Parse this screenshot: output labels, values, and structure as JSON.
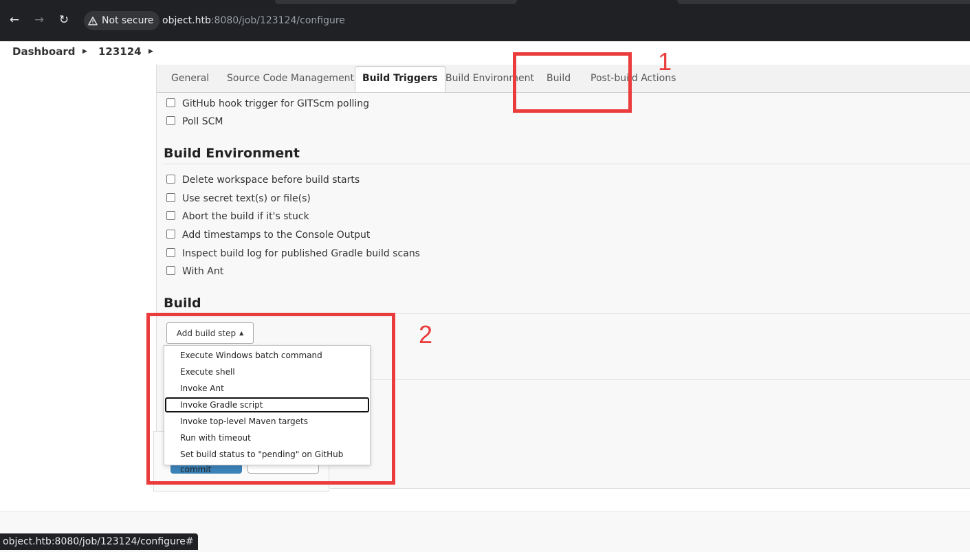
{
  "browser": {
    "security_label": "Not secure",
    "url_host": "object.htb",
    "url_path": ":8080/job/123124/configure",
    "status_url": "object.htb:8080/job/123124/configure#"
  },
  "breadcrumbs": {
    "dashboard": "Dashboard",
    "job": "123124"
  },
  "tabs": [
    {
      "label": "General"
    },
    {
      "label": "Source Code Management"
    },
    {
      "label": "Build Triggers"
    },
    {
      "label": "Build Environment"
    },
    {
      "label": "Build"
    },
    {
      "label": "Post-build Actions"
    }
  ],
  "build_triggers": {
    "options": [
      {
        "label": "GitHub hook trigger for GITScm polling",
        "checked": false
      },
      {
        "label": "Poll SCM",
        "checked": false
      }
    ]
  },
  "build_environment": {
    "title": "Build Environment",
    "options": [
      {
        "label": "Delete workspace before build starts",
        "checked": false
      },
      {
        "label": "Use secret text(s) or file(s)",
        "checked": false
      },
      {
        "label": "Abort the build if it's stuck",
        "checked": false
      },
      {
        "label": "Add timestamps to the Console Output",
        "checked": false
      },
      {
        "label": "Inspect build log for published Gradle build scans",
        "checked": false
      },
      {
        "label": "With Ant",
        "checked": false
      }
    ]
  },
  "build": {
    "title": "Build",
    "add_step_label": "Add build step",
    "menu": [
      {
        "label": "Execute Windows batch command"
      },
      {
        "label": "Execute shell"
      },
      {
        "label": "Invoke Ant"
      },
      {
        "label": "Invoke Gradle script",
        "focused": true
      },
      {
        "label": "Invoke top-level Maven targets"
      },
      {
        "label": "Run with timeout"
      },
      {
        "label": "Set build status to \"pending\" on GitHub commit"
      }
    ]
  },
  "annotations": [
    {
      "label": "1"
    },
    {
      "label": "2"
    }
  ],
  "colors": {
    "annotation": "#ea3c3c",
    "browser_bg": "#202124",
    "save_button": "#3b82b8"
  }
}
